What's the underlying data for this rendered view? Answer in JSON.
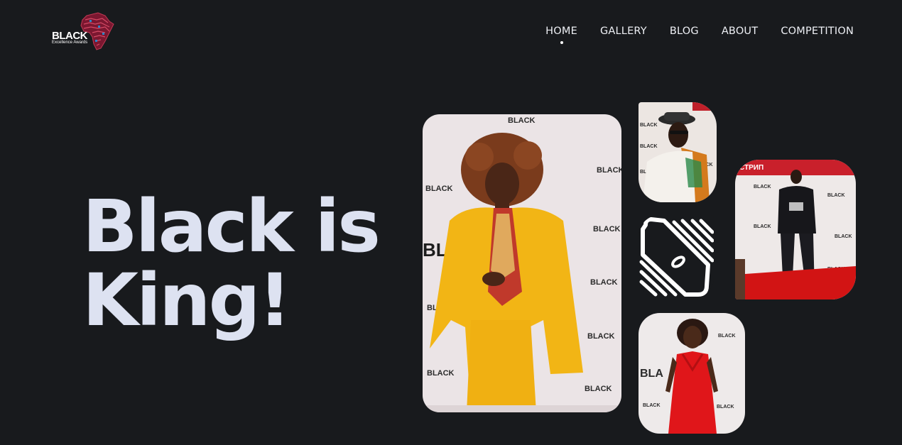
{
  "brand": {
    "word": "BLACK",
    "sub": "Excellence Awards"
  },
  "nav": {
    "items": [
      {
        "label": "HOME",
        "active": true
      },
      {
        "label": "GALLERY",
        "active": false
      },
      {
        "label": "BLOG",
        "active": false
      },
      {
        "label": "ABOUT",
        "active": false
      },
      {
        "label": "COMPETITION",
        "active": false
      }
    ]
  },
  "hero": {
    "line1": "Black is",
    "line2": "King!"
  },
  "gallery": {
    "tiles": [
      {
        "subject": "woman in yellow suit",
        "color": "#f5b51a"
      },
      {
        "subject": "man with hat and sunglasses",
        "color": "#f1ece4"
      },
      {
        "subject": "brand pattern icon",
        "color": "#ffffff"
      },
      {
        "subject": "man on red carpet",
        "color": "#1d1f27"
      },
      {
        "subject": "woman in red dress",
        "color": "#e11d1d"
      }
    ]
  },
  "colors": {
    "background": "#181a1d",
    "hero_text": "#dde2f1",
    "nav_text": "#eef0f5"
  }
}
